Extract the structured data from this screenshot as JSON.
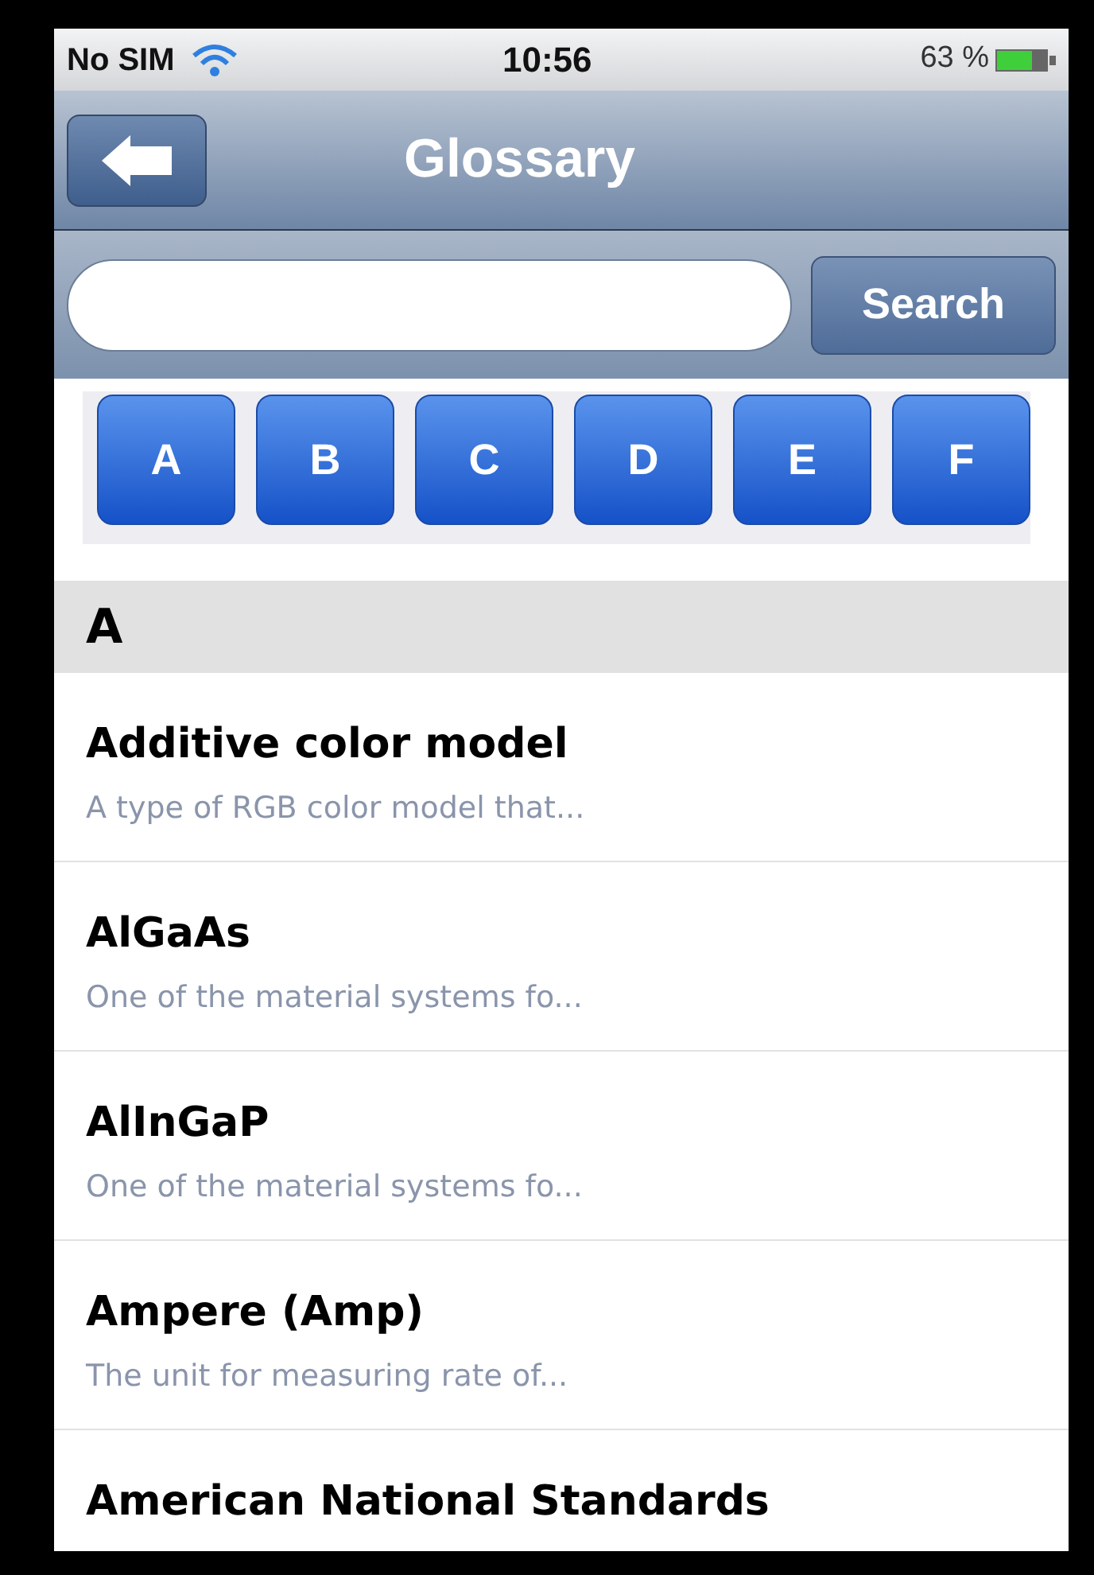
{
  "status_bar": {
    "carrier": "No SIM",
    "time": "10:56",
    "battery": "63 %"
  },
  "nav_bar": {
    "title": "Glossary"
  },
  "search": {
    "button": "Search"
  },
  "letters": [
    {
      "label": "A"
    },
    {
      "label": "B"
    },
    {
      "label": "C"
    },
    {
      "label": "D"
    },
    {
      "label": "E"
    },
    {
      "label": "F"
    }
  ],
  "section": {
    "header": "A"
  },
  "entries": [
    {
      "term": "Additive color model",
      "summary": "A type of RGB color model that..."
    },
    {
      "term": "AlGaAs",
      "summary": "One of the material systems fo..."
    },
    {
      "term": "AlInGaP",
      "summary": "One of the material systems fo..."
    },
    {
      "term": "Ampere (Amp)",
      "summary": "The unit for measuring rate of..."
    },
    {
      "term": "American National Standards"
    }
  ]
}
